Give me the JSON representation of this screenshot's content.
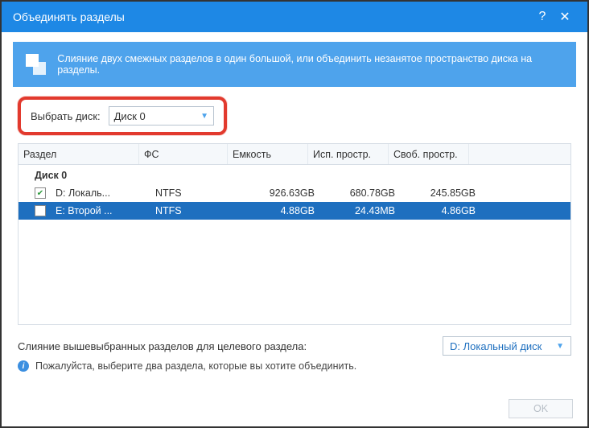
{
  "title": "Объединять разделы",
  "banner": "Слияние двух смежных разделов в один большой, или объединить незанятое пространство диска на разделы.",
  "select_label": "Выбрать диск:",
  "selected_disk": "Диск 0",
  "columns": {
    "c1": "Раздел",
    "c2": "ФС",
    "c3": "Емкость",
    "c4": "Исп. простр.",
    "c5": "Своб. простр."
  },
  "disk_group": "Диск 0",
  "rows": [
    {
      "checked": true,
      "name": "D:  Локаль...",
      "fs": "NTFS",
      "cap": "926.63GB",
      "used": "680.78GB",
      "free": "245.85GB"
    },
    {
      "checked": false,
      "name": "E:  Второй ...",
      "fs": "NTFS",
      "cap": "4.88GB",
      "used": "24.43MB",
      "free": "4.86GB"
    }
  ],
  "merge_label": "Слияние вышевыбранных разделов для целевого раздела:",
  "target_partition": "D:  Локальный диск",
  "info_text": "Пожалуйста, выберите два раздела, которые вы хотите объединить.",
  "ok": "OK"
}
